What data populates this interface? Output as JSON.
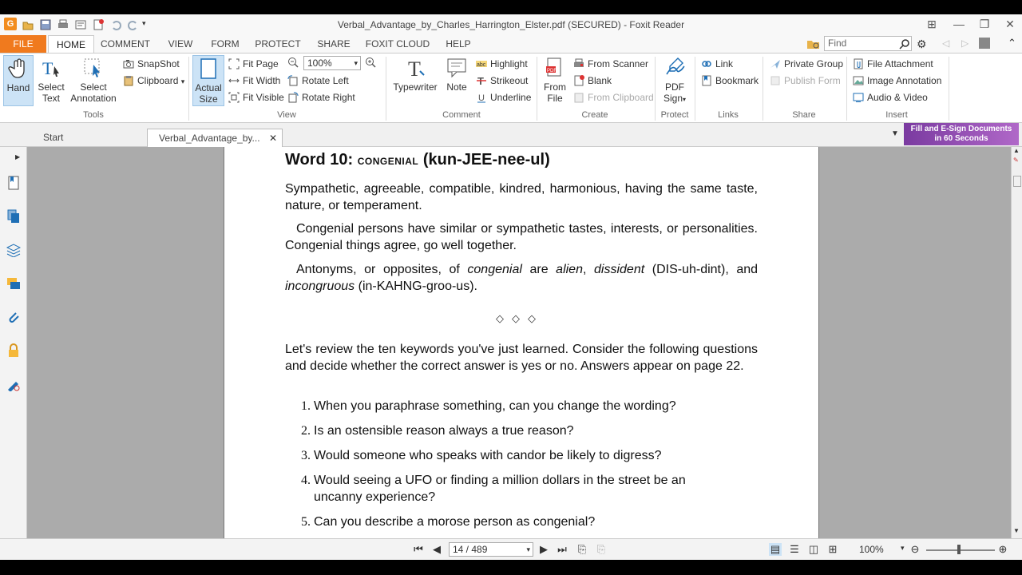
{
  "window": {
    "title": "Verbal_Advantage_by_Charles_Harrington_Elster.pdf (SECURED) - Foxit Reader",
    "app_logo": "G",
    "controls": [
      "⊞",
      "—",
      "❐",
      "✕"
    ]
  },
  "ribbon_tabs": [
    "FILE",
    "HOME",
    "COMMENT",
    "VIEW",
    "FORM",
    "PROTECT",
    "SHARE",
    "FOXIT CLOUD",
    "HELP"
  ],
  "search": {
    "placeholder": "Find"
  },
  "groups": {
    "tools": {
      "label": "Tools",
      "hand": "Hand",
      "select_text_1": "Select",
      "select_text_2": "Text",
      "select_annotation_1": "Select",
      "select_annotation_2": "Annotation",
      "snapshot": "SnapShot",
      "clipboard": "Clipboard"
    },
    "view": {
      "label": "View",
      "actual_size_1": "Actual",
      "actual_size_2": "Size",
      "fit_page": "Fit Page",
      "fit_width": "Fit Width",
      "fit_visible": "Fit Visible",
      "zoom": "100%",
      "rotate_left": "Rotate Left",
      "rotate_right": "Rotate Right"
    },
    "comment": {
      "label": "Comment",
      "typewriter": "Typewriter",
      "note": "Note",
      "highlight": "Highlight",
      "strikeout": "Strikeout",
      "underline": "Underline"
    },
    "create": {
      "label": "Create",
      "from_file_1": "From",
      "from_file_2": "File",
      "from_scanner": "From Scanner",
      "blank": "Blank",
      "from_clipboard": "From Clipboard"
    },
    "protect": {
      "label": "Protect",
      "pdf_sign_1": "PDF",
      "pdf_sign_2": "Sign"
    },
    "links": {
      "label": "Links",
      "link": "Link",
      "bookmark": "Bookmark"
    },
    "share": {
      "label": "Share",
      "private_group": "Private Group",
      "publish_form": "Publish Form"
    },
    "insert": {
      "label": "Insert",
      "file_attachment": "File Attachment",
      "image_annotation": "Image Annotation",
      "audio_video": "Audio & Video"
    }
  },
  "doc_tabs": {
    "start": "Start",
    "doc": "Verbal_Advantage_by...",
    "close": "✕"
  },
  "promo": {
    "line1": "Fill and E-Sign Documents",
    "line2": "in 60 Seconds"
  },
  "page_content": {
    "heading_word": "Word 10:",
    "heading_sc": "CONGENIAL",
    "heading_pron": "(kun-JEE-nee-ul)",
    "def": "Sympathetic, agreeable, compatible, kindred, harmonious, having the same taste, nature, or temperament.",
    "p1": "Congenial persons have similar or sympathetic tastes, interests, or personalities. Congenial things agree, go well together.",
    "p2_a": "Antonyms, or opposites, of ",
    "p2_b": "congenial",
    "p2_c": " are ",
    "p2_d": "alien",
    "p2_e": ", ",
    "p2_f": "dissident",
    "p2_g": " (DIS-uh-dint), and ",
    "p2_h": "incongruous",
    "p2_i": " (in-KAHNG-groo-us).",
    "ornament": "◇◇◇",
    "review": "Let's review the ten keywords you've just learned. Consider the following questions and decide whether the correct answer is yes or no. Answers appear on page 22.",
    "questions": [
      {
        "n": "1.",
        "text": "When you paraphrase something, can you change the wording?"
      },
      {
        "n": "2.",
        "text": "Is an ostensible reason always a true reason?"
      },
      {
        "n": "3.",
        "text": "Would someone who speaks with candor be likely to digress?"
      },
      {
        "n": "4.",
        "text": "Would seeing a UFO or finding a million dollars in the street be an uncanny experience?"
      },
      {
        "n": "5.",
        "text": "Can you describe a morose person as congenial?"
      }
    ]
  },
  "status": {
    "page": "14 / 489",
    "zoom": "100%"
  },
  "colors": {
    "file_tab": "#f07a1e",
    "accent": "#1f6fb5",
    "promo": "#9b4fbf"
  }
}
